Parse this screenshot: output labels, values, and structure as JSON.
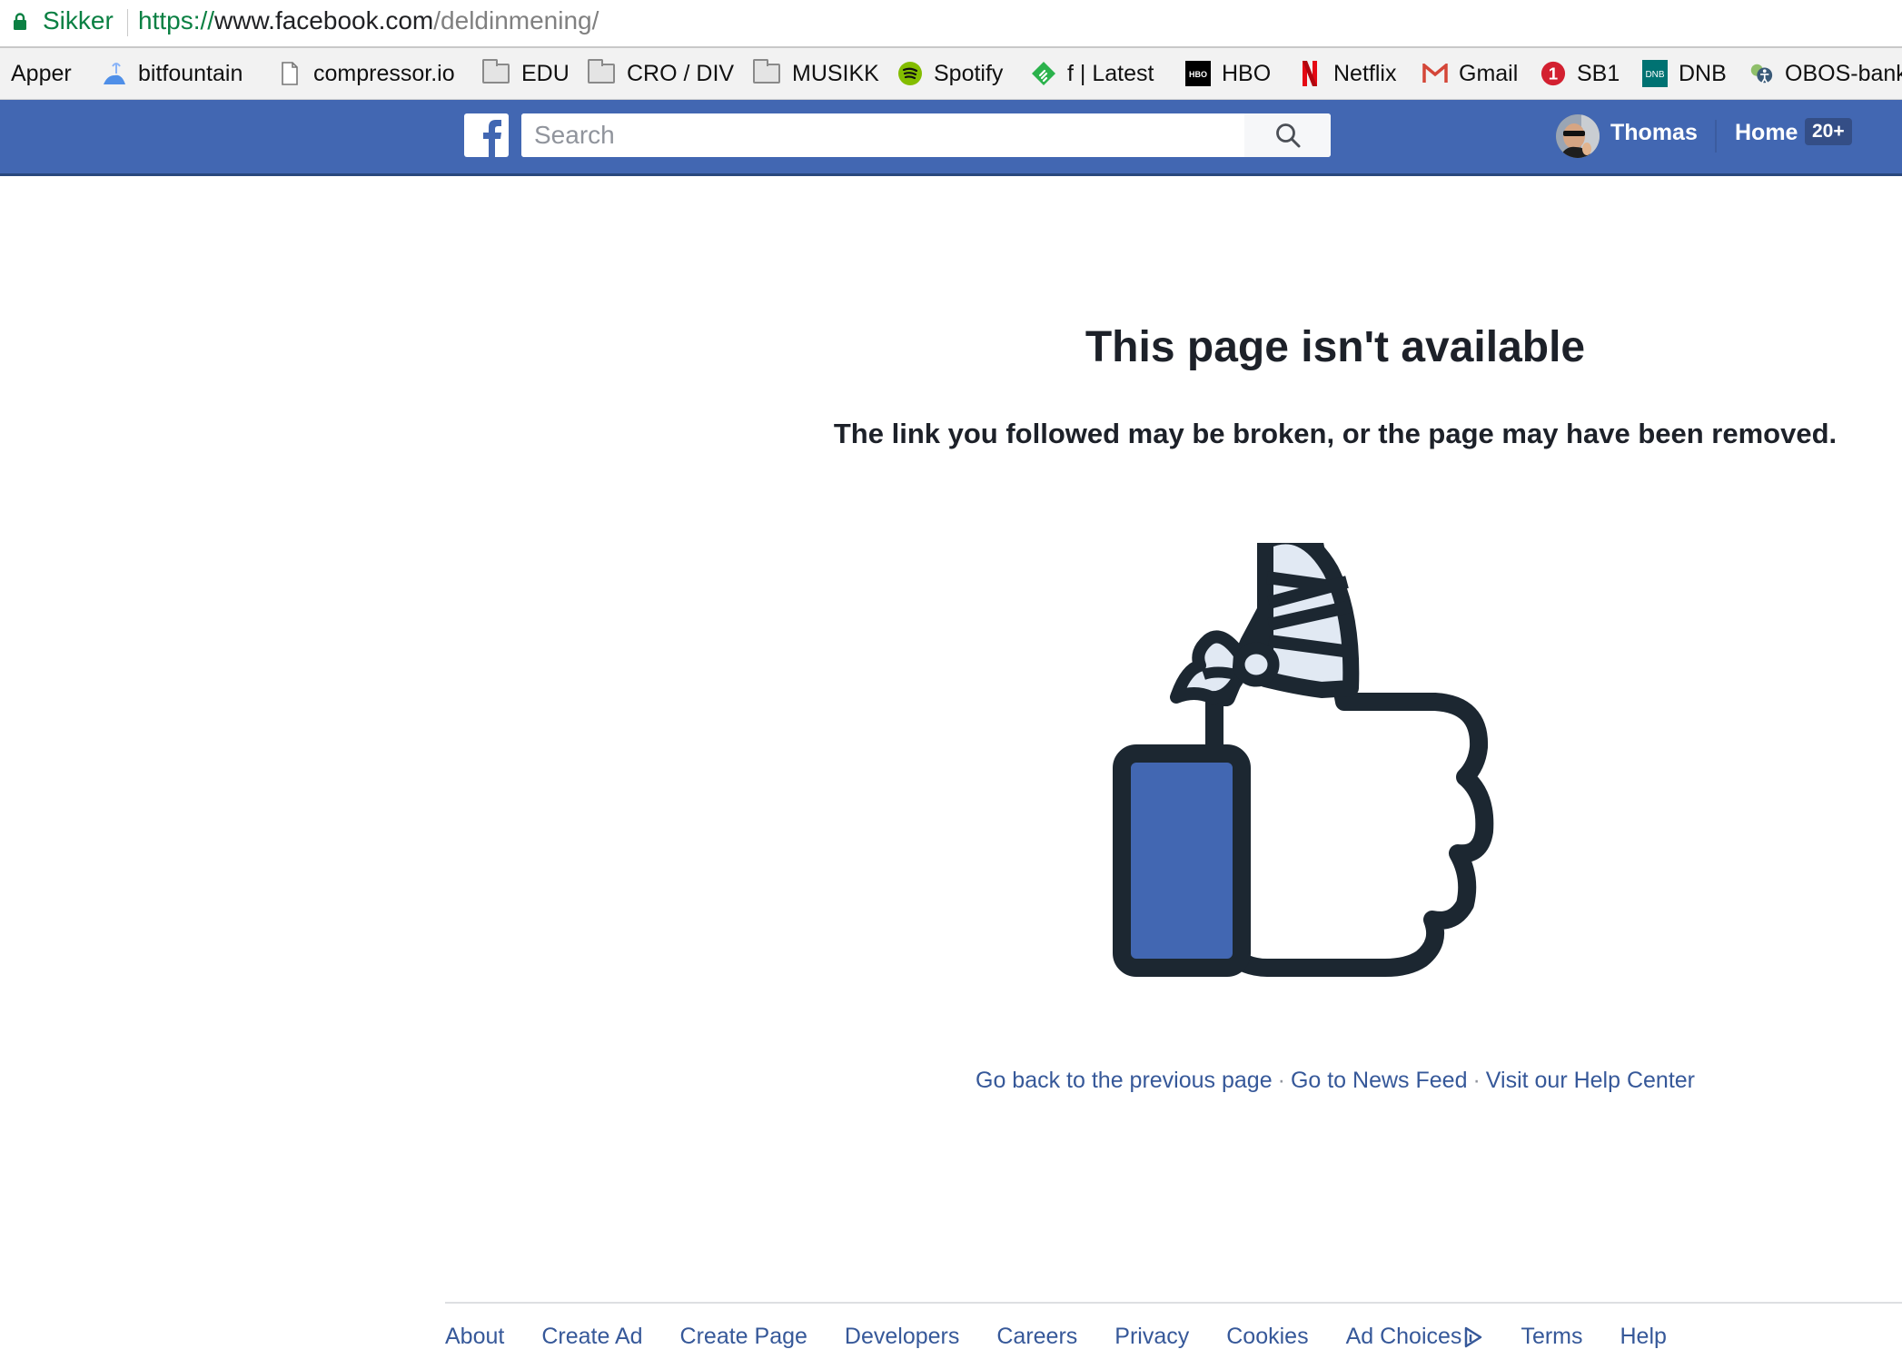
{
  "browser": {
    "secure_label": "Sikker",
    "url_scheme": "https://",
    "url_host": "www.facebook.com",
    "url_path": "/deldinmening/",
    "bookmarks": [
      {
        "label": "Apper",
        "icon": "apps-grid-icon"
      },
      {
        "label": "bitfountain",
        "icon": "bitfountain-icon"
      },
      {
        "label": "compressor.io",
        "icon": "page-icon"
      },
      {
        "label": "EDU",
        "icon": "folder-icon"
      },
      {
        "label": "CRO / DIV",
        "icon": "folder-icon"
      },
      {
        "label": "MUSIKK",
        "icon": "folder-icon"
      },
      {
        "label": "Spotify",
        "icon": "spotify-icon"
      },
      {
        "label": "f | Latest",
        "icon": "feedly-icon"
      },
      {
        "label": "HBO",
        "icon": "hbo-icon"
      },
      {
        "label": "Netflix",
        "icon": "netflix-icon"
      },
      {
        "label": "Gmail",
        "icon": "gmail-icon"
      },
      {
        "label": "SB1",
        "icon": "sb1-icon"
      },
      {
        "label": "DNB",
        "icon": "dnb-icon"
      },
      {
        "label": "OBOS-bank",
        "icon": "obos-icon"
      }
    ]
  },
  "header": {
    "search_placeholder": "Search",
    "user_name": "Thomas",
    "home_label": "Home",
    "home_badge": "20+",
    "brand_color": "#4267b2"
  },
  "main": {
    "title": "This page isn't available",
    "subtitle": "The link you followed may be broken, or the page may have been removed.",
    "illustration": "broken-thumbs-up-icon",
    "links": [
      {
        "label": "Go back to the previous page"
      },
      {
        "label": "Go to News Feed"
      },
      {
        "label": "Visit our Help Center"
      }
    ],
    "separator": "·"
  },
  "footer": {
    "links": [
      {
        "label": "About"
      },
      {
        "label": "Create Ad"
      },
      {
        "label": "Create Page"
      },
      {
        "label": "Developers"
      },
      {
        "label": "Careers"
      },
      {
        "label": "Privacy"
      },
      {
        "label": "Cookies"
      },
      {
        "label": "Ad Choices"
      },
      {
        "label": "Terms"
      },
      {
        "label": "Help"
      }
    ]
  }
}
